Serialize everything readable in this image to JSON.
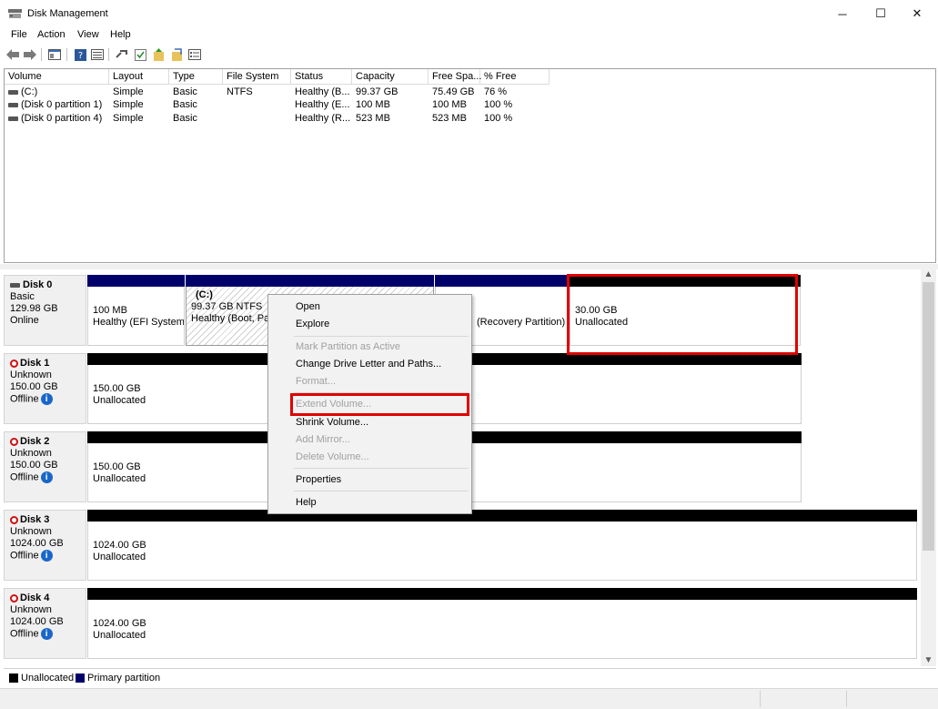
{
  "window": {
    "title": "Disk Management",
    "controls": {
      "minimize": "─",
      "maximize": "☐",
      "close": "✕"
    }
  },
  "menu": [
    "File",
    "Action",
    "View",
    "Help"
  ],
  "toolbar": [
    "back-icon",
    "forward-icon",
    "console-icon",
    "help-icon",
    "properties-icon",
    "connect-icon",
    "check-icon",
    "rescan-icon",
    "wizard-icon",
    "list-icon"
  ],
  "volume_table": {
    "headers": [
      "Volume",
      "Layout",
      "Type",
      "File System",
      "Status",
      "Capacity",
      "Free Spa...",
      "% Free"
    ],
    "rows": [
      [
        "(C:)",
        "Simple",
        "Basic",
        "NTFS",
        "Healthy (B...",
        "99.37 GB",
        "75.49 GB",
        "76 %"
      ],
      [
        "(Disk 0 partition 1)",
        "Simple",
        "Basic",
        "",
        "Healthy (E...",
        "100 MB",
        "100 MB",
        "100 %"
      ],
      [
        "(Disk 0 partition 4)",
        "Simple",
        "Basic",
        "",
        "Healthy (R...",
        "523 MB",
        "523 MB",
        "100 %"
      ]
    ]
  },
  "disks": [
    {
      "name": "Disk 0",
      "type": "Basic",
      "size": "129.98 GB",
      "state": "Online",
      "partitions": [
        {
          "line1": "100 MB",
          "line2": "Healthy (EFI System P"
        },
        {
          "line0": "(C:)",
          "line1": "99.37 GB NTFS",
          "line2": "Healthy (Boot, Page"
        },
        {
          "line1": "",
          "line2": "(Recovery Partition)"
        },
        {
          "line1": "30.00 GB",
          "line2": "Unallocated"
        }
      ]
    },
    {
      "name": "Disk 1",
      "type": "Unknown",
      "size": "150.00 GB",
      "state": "Offline",
      "partitions": [
        {
          "line1": "150.00 GB",
          "line2": "Unallocated"
        }
      ]
    },
    {
      "name": "Disk 2",
      "type": "Unknown",
      "size": "150.00 GB",
      "state": "Offline",
      "partitions": [
        {
          "line1": "150.00 GB",
          "line2": "Unallocated"
        }
      ]
    },
    {
      "name": "Disk 3",
      "type": "Unknown",
      "size": "1024.00 GB",
      "state": "Offline",
      "partitions": [
        {
          "line1": "1024.00 GB",
          "line2": "Unallocated"
        }
      ]
    },
    {
      "name": "Disk 4",
      "type": "Unknown",
      "size": "1024.00 GB",
      "state": "Offline",
      "partitions": [
        {
          "line1": "1024.00 GB",
          "line2": "Unallocated"
        }
      ]
    }
  ],
  "context_menu": {
    "open": "Open",
    "explore": "Explore",
    "mark_active": "Mark Partition as Active",
    "change_letter": "Change Drive Letter and Paths...",
    "format": "Format...",
    "extend": "Extend Volume...",
    "shrink": "Shrink Volume...",
    "add_mirror": "Add Mirror...",
    "delete": "Delete Volume...",
    "properties": "Properties",
    "help": "Help"
  },
  "legend": {
    "unallocated": "Unallocated",
    "primary": "Primary partition",
    "unallocated_color": "#000000",
    "primary_color": "#00006b"
  },
  "highlight_color": "#e00000"
}
